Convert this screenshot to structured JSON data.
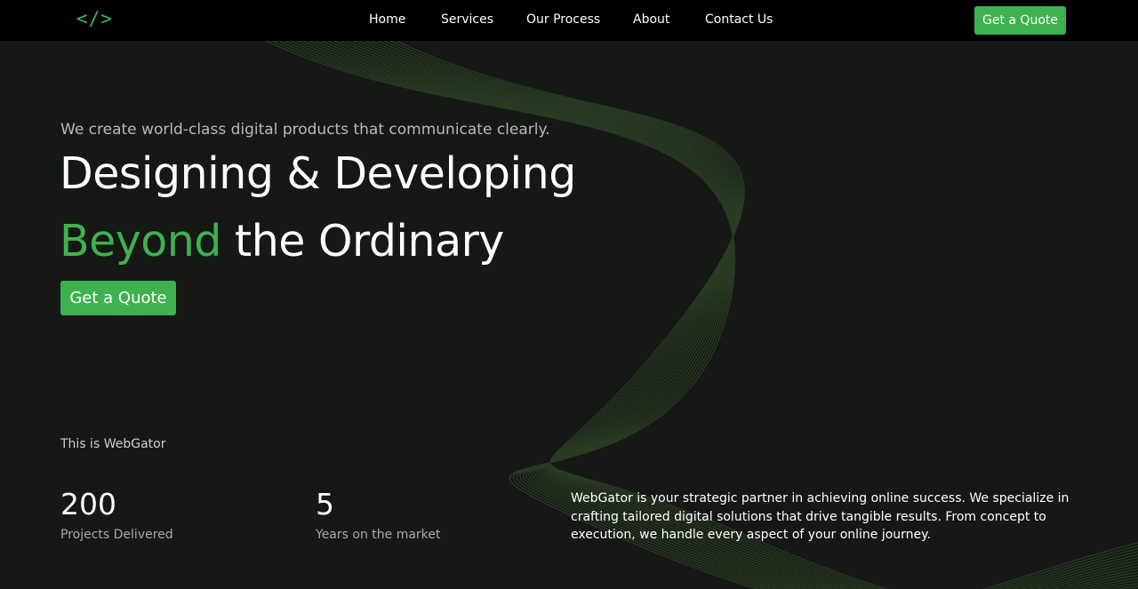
{
  "brand": {
    "logo_text": "</>",
    "logo_color": "#3fb54f"
  },
  "nav": {
    "items": [
      {
        "label": "Home"
      },
      {
        "label": "Services"
      },
      {
        "label": "Our Process"
      },
      {
        "label": "About"
      },
      {
        "label": "Contact Us"
      }
    ],
    "cta_label": "Get a Quote"
  },
  "hero": {
    "tagline": "We create world-class digital products that communicate clearly.",
    "headline_line1": "Designing & Developing",
    "headline_accent": "Beyond",
    "headline_rest": " the Ordinary",
    "cta_label": "Get a Quote"
  },
  "about": {
    "label": "This is WebGator",
    "stats": [
      {
        "value": "200",
        "label": "Projects Delivered"
      },
      {
        "value": "5",
        "label": "Years on the market"
      }
    ],
    "description": "WebGator is your strategic partner in achieving online success. We specialize in crafting tailored digital solutions that drive tangible results. From concept to execution, we handle every aspect of your online journey."
  },
  "colors": {
    "accent": "#3eb24f",
    "background": "#151815",
    "topbar": "#000000"
  }
}
